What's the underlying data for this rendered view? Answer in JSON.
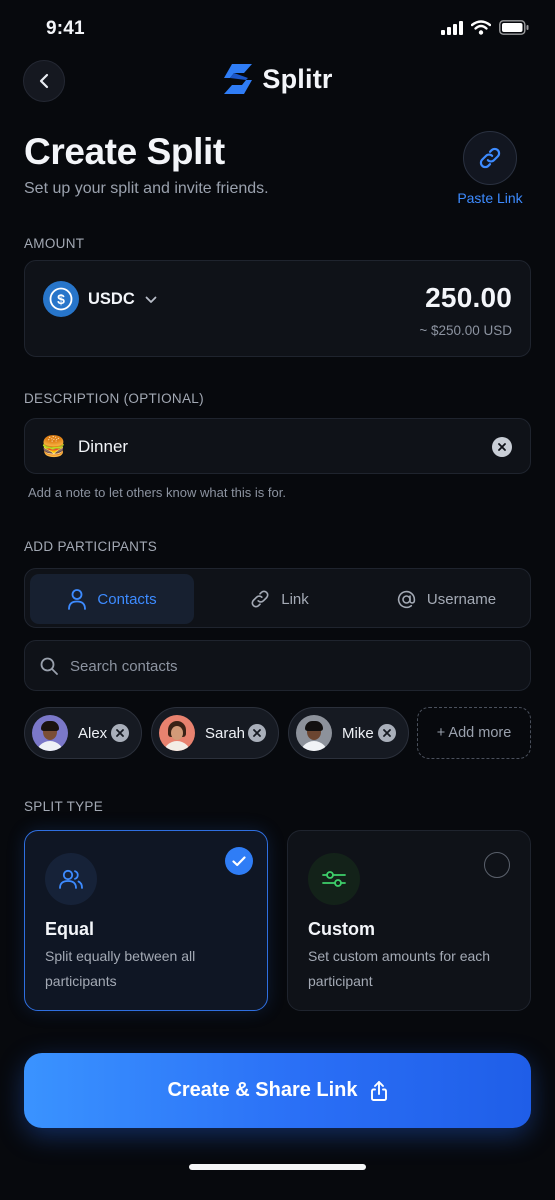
{
  "status_bar": {
    "time": "9:41"
  },
  "header": {
    "brand": "Splitr"
  },
  "page": {
    "title": "Create Split",
    "subtitle": "Set up your split and invite friends.",
    "paste_link_label": "Paste Link"
  },
  "amount": {
    "section_label": "AMOUNT",
    "token": "USDC",
    "value": "250.00",
    "fiat_equivalent": "~ $250.00 USD"
  },
  "description": {
    "section_label": "DESCRIPTION (OPTIONAL)",
    "emoji": "🍔",
    "value": "Dinner",
    "hint": "Add a note to let others know what this is for."
  },
  "participants": {
    "section_label": "ADD PARTICIPANTS",
    "tabs": [
      {
        "label": "Contacts",
        "active": true
      },
      {
        "label": "Link",
        "active": false
      },
      {
        "label": "Username",
        "active": false
      }
    ],
    "search_placeholder": "Search contacts",
    "selected": [
      {
        "name": "Alex"
      },
      {
        "name": "Sarah"
      },
      {
        "name": "Mike"
      }
    ],
    "add_more_label": "+ Add more"
  },
  "split_type": {
    "section_label": "SPLIT TYPE",
    "options": [
      {
        "title": "Equal",
        "description": "Split equally between all participants",
        "selected": true,
        "icon": "users-icon"
      },
      {
        "title": "Custom",
        "description": "Set custom amounts for each participant",
        "selected": false,
        "icon": "sliders-icon"
      }
    ]
  },
  "cta": {
    "label": "Create & Share Link",
    "icon": "share-icon"
  },
  "colors": {
    "accent": "#2f7df6",
    "background": "#07090d",
    "custom_icon": "#3ecf6a"
  }
}
